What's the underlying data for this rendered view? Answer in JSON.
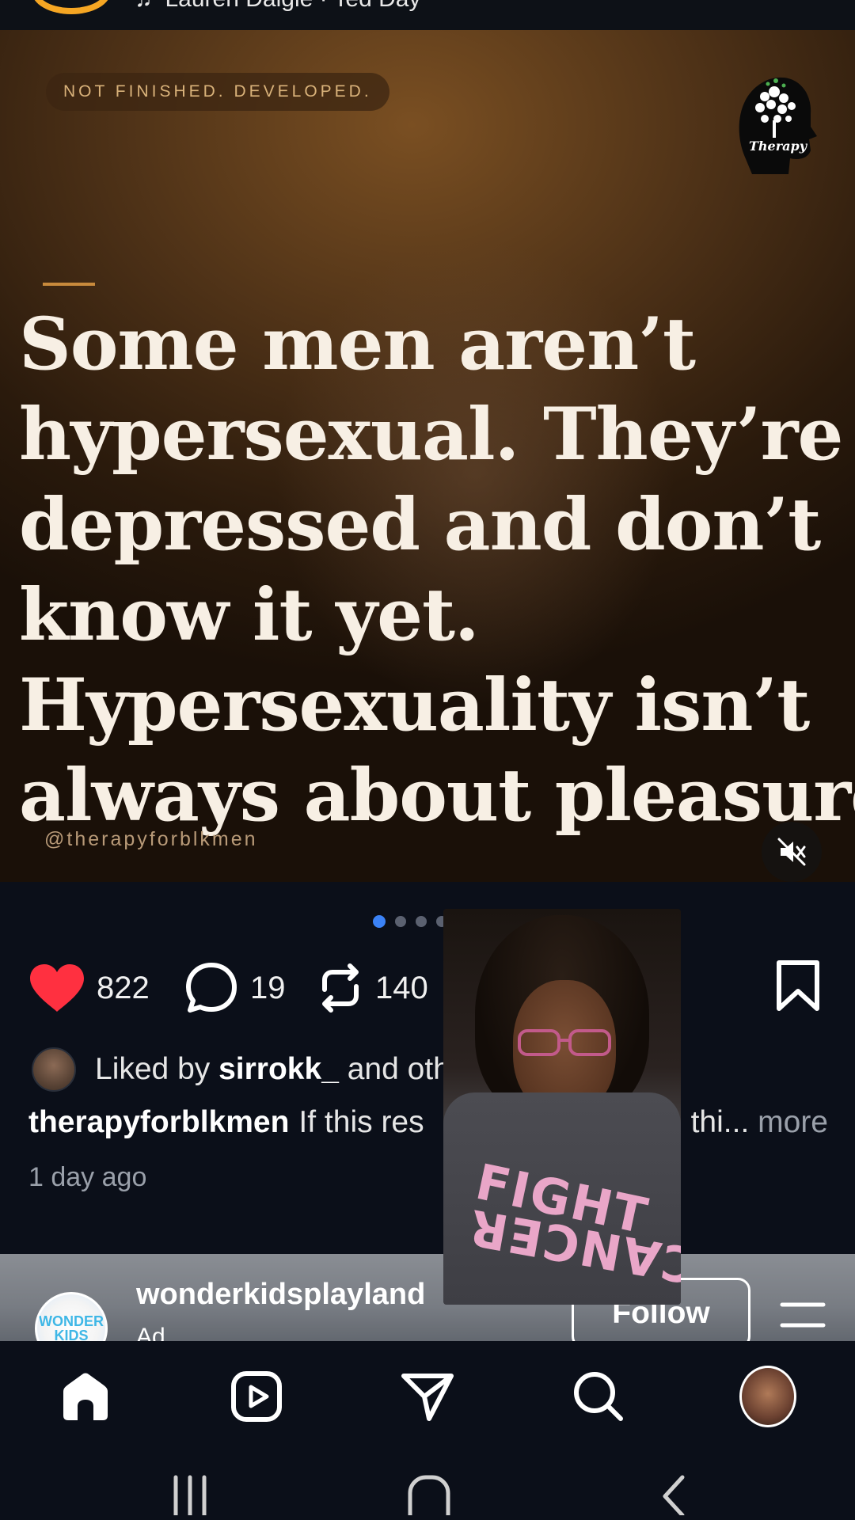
{
  "top_bar": {
    "music_text": "Lauren Daigle · Ted Day"
  },
  "post": {
    "tag_pill": "NOT FINISHED. DEVELOPED.",
    "logo_text": "Therapy",
    "quote_lines": [
      "Some men aren’t",
      "hypersexual. They’re",
      "depressed and don’t",
      "know it yet.",
      "Hypersexuality isn’t",
      "always about pleasure"
    ],
    "watermark": "@therapyforblkmen",
    "carousel": {
      "total_dots": 6,
      "active_index": 0
    }
  },
  "actions": {
    "likes": "822",
    "comments": "19",
    "reposts": "140"
  },
  "liked_by": {
    "prefix": "Liked by ",
    "user": "sirrokk_",
    "suffix": " and others"
  },
  "caption": {
    "username": "therapyforblkmen",
    "text": "If this res",
    "tail": "thi...",
    "more_label": "more"
  },
  "time_ago": "1 day ago",
  "overlay": {
    "shirt_line1": "FIGHT",
    "shirt_line2": "CANCER"
  },
  "next_post": {
    "avatar_text": "WONDER KIDS",
    "username": "wonderkidsplayland",
    "ad_label": "Ad",
    "follow_label": "Follow"
  },
  "colors": {
    "accent": "#3b82f6",
    "like": "#ff3040",
    "pill_text": "#d9b27a",
    "background": "#0b0f19"
  }
}
